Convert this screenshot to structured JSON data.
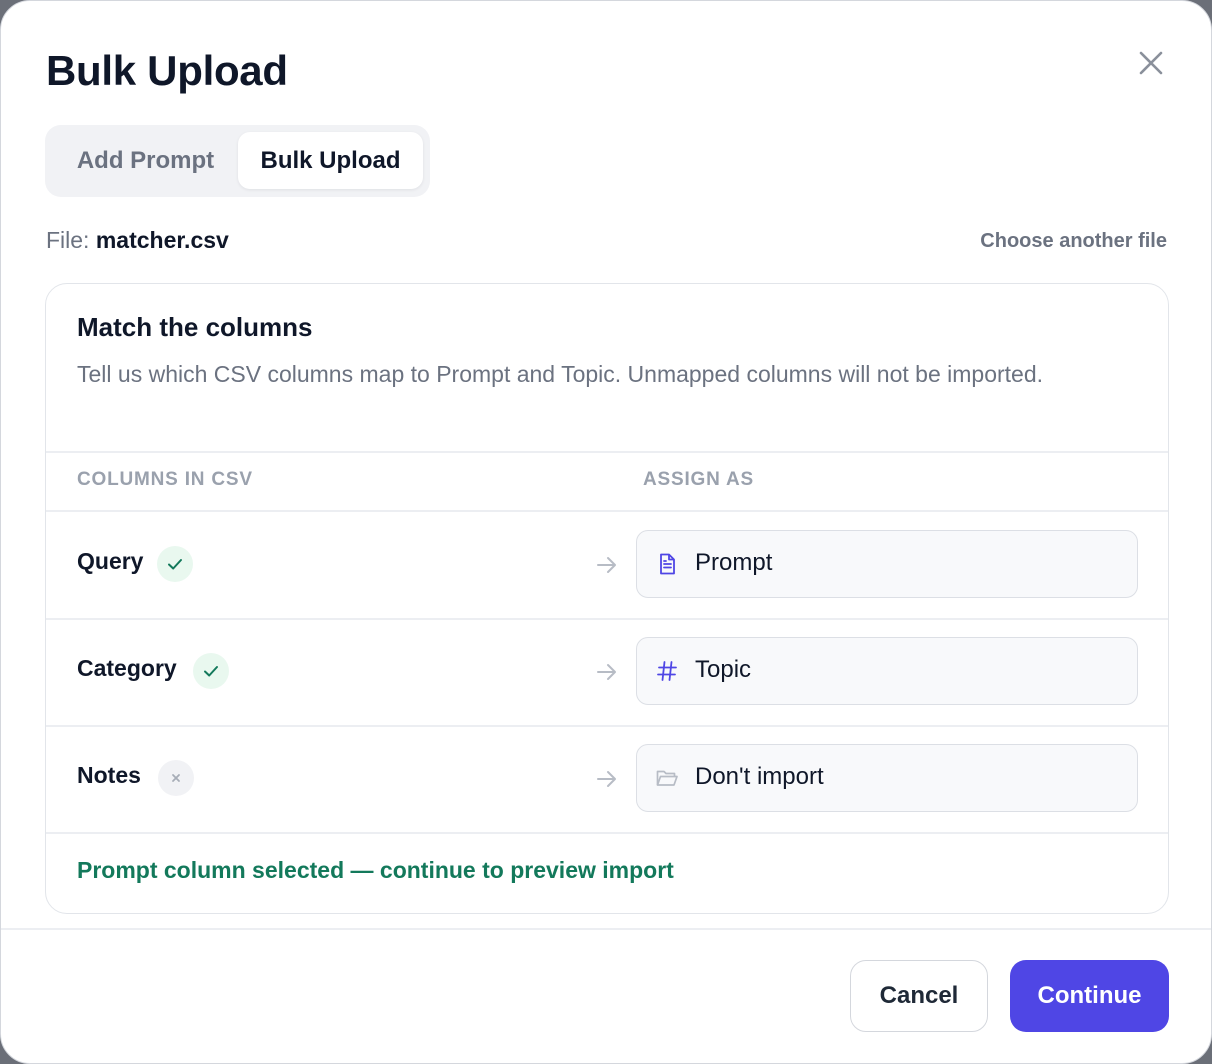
{
  "dialog": {
    "title": "Bulk Upload",
    "close_icon": "close-icon"
  },
  "tabs": [
    {
      "label": "Add Prompt",
      "active": false
    },
    {
      "label": "Bulk Upload",
      "active": true
    }
  ],
  "file": {
    "label": "File:",
    "name": "matcher.csv",
    "choose_another": "Choose another file"
  },
  "mapping": {
    "title": "Match the columns",
    "description": "Tell us which CSV columns map to Prompt and Topic. Unmapped columns will not be imported.",
    "header_columns": "COLUMNS IN CSV",
    "header_assign": "ASSIGN AS",
    "rows": [
      {
        "column": "Query",
        "status": "mapped",
        "status_icon": "check-icon",
        "assign": "Prompt",
        "assign_icon": "document-icon"
      },
      {
        "column": "Category",
        "status": "mapped",
        "status_icon": "check-icon",
        "assign": "Topic",
        "assign_icon": "hash-icon"
      },
      {
        "column": "Notes",
        "status": "unmapped",
        "status_icon": "x-icon",
        "assign": "Don't import",
        "assign_icon": "folder-icon"
      }
    ],
    "status_message": "Prompt column selected — continue to preview import"
  },
  "footer": {
    "cancel_label": "Cancel",
    "continue_label": "Continue"
  },
  "colors": {
    "accent": "#4f46e5",
    "success": "#13795b",
    "success_bg": "#e9f8ef",
    "text_primary": "#0f1729",
    "text_secondary": "#6b7280"
  }
}
